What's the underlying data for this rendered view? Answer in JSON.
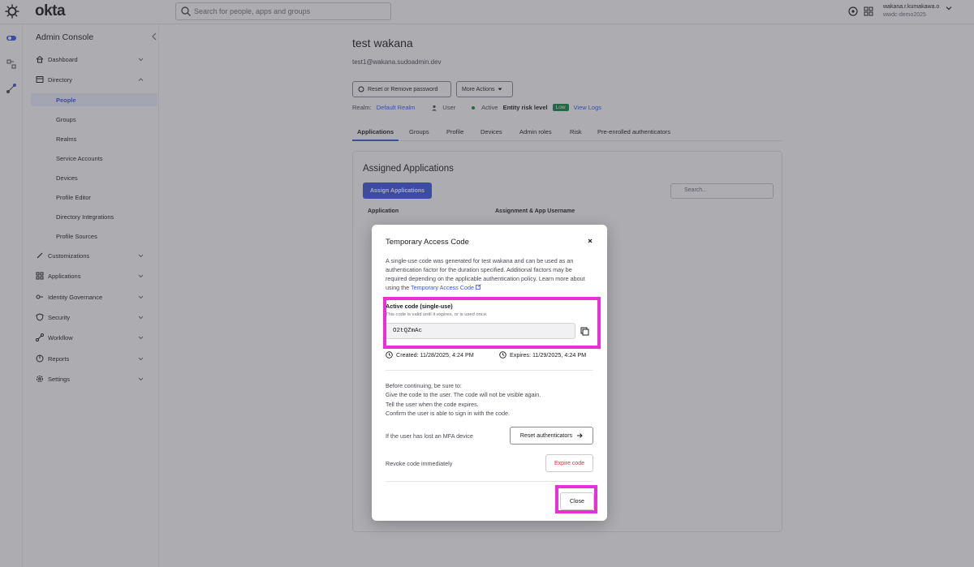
{
  "topbar": {
    "brand": "okta",
    "search_placeholder": "Search for people, apps and groups",
    "user_name": "wakana.r.kumakawa.o",
    "user_org": "wwdc-demo2025"
  },
  "sidebar": {
    "title": "Admin Console",
    "items": [
      {
        "label": "Dashboard",
        "icon": "home-icon"
      },
      {
        "label": "Directory",
        "icon": "directory-icon"
      },
      {
        "label": "Customizations",
        "icon": "brush-icon"
      },
      {
        "label": "Applications",
        "icon": "grid-icon"
      },
      {
        "label": "Identity Governance",
        "icon": "key-icon"
      },
      {
        "label": "Security",
        "icon": "shield-icon"
      },
      {
        "label": "Workflow",
        "icon": "workflow-icon"
      },
      {
        "label": "Reports",
        "icon": "chart-icon"
      },
      {
        "label": "Settings",
        "icon": "gear-icon"
      }
    ],
    "directory_sub": [
      "People",
      "Groups",
      "Realms",
      "Service Accounts",
      "Devices",
      "Profile Editor",
      "Directory Integrations",
      "Profile Sources"
    ]
  },
  "main": {
    "title": "test wakana",
    "email": "test1@wakana.sudoadmin.dev",
    "reset_button": "Reset or Remove password",
    "more_actions": "More Actions",
    "realm_label": "Realm:",
    "realm_value": "Default Realm",
    "user_type": "User",
    "status": "Active",
    "risk_label": "Entity risk level",
    "risk_value": "Low",
    "view_logs": "View Logs",
    "tabs": [
      "Applications",
      "Groups",
      "Profile",
      "Devices",
      "Admin roles",
      "Risk",
      "Pre-enrolled authenticators"
    ],
    "card_title": "Assigned Applications",
    "assign_button": "Assign Applications",
    "card_search_placeholder": "Search...",
    "col_application": "Application",
    "col_assignment": "Assignment & App Username"
  },
  "modal": {
    "title": "Temporary Access Code",
    "description": "A single-use code was generated for test wakana and can be used as an authentication factor for the duration specified. Additional factors may be required depending on the applicable authentication policy. Learn more about using the ",
    "description_link": "Temporary Access Code",
    "code_label": "Active code (single-use)",
    "code_help": "This code is valid until it expires, or is used once.",
    "code_value": "O2tQZmAc",
    "created": "Created: 11/28/2025, 4:24 PM",
    "expires": "Expires: 11/29/2025, 4:24 PM",
    "checklist_intro": "Before continuing, be sure to:",
    "checklist": [
      "Give the code to the user. The code will not be visible again.",
      "Tell the user when the code expires.",
      "Confirm the user is able to sign in with the code."
    ],
    "lost_device_label": "If the user has lost an MFA device",
    "reset_auth_button": "Reset authenticators",
    "revoke_label": "Revoke code immediately",
    "expire_button": "Expire code",
    "close_button": "Close"
  },
  "colors": {
    "accent": "#3f59e4",
    "highlight": "#ea2fd6",
    "danger": "#d1323c",
    "success": "#16834a"
  }
}
